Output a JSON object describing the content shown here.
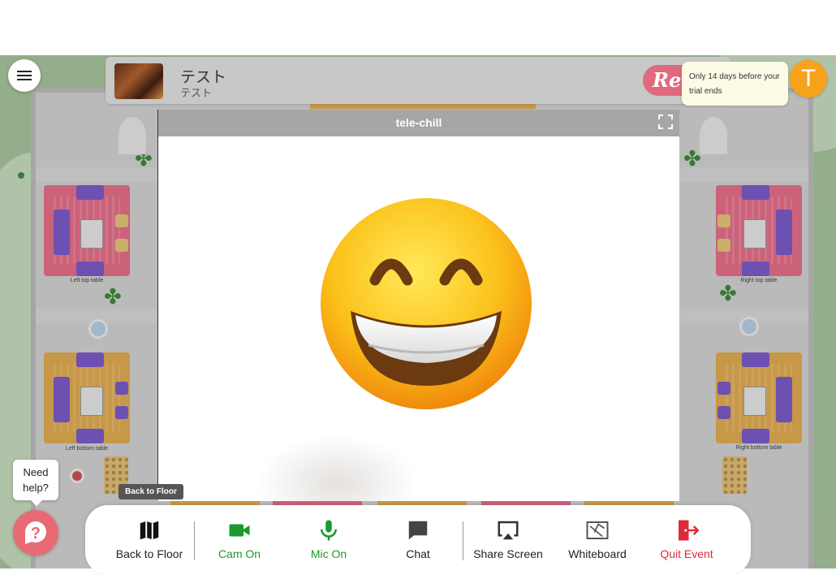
{
  "event": {
    "title": "テスト",
    "subtitle": "テスト",
    "brand_text": "Re"
  },
  "trial_notice": "Only 14 days before your trial ends",
  "avatar_initial": "T",
  "video": {
    "title": "tele-chill"
  },
  "tooltip": "Back to Floor",
  "help": {
    "text_line1": "Need",
    "text_line2": "help?"
  },
  "tables": {
    "left_top": "Left top table",
    "right_top": "Right top table",
    "left_bottom": "Left bottom table",
    "right_bottom": "Right bottom table"
  },
  "toolbar": {
    "back_to_floor": "Back to Floor",
    "cam_on": "Cam On",
    "mic_on": "Mic On",
    "chat": "Chat",
    "share_screen": "Share Screen",
    "whiteboard": "Whiteboard",
    "quit_event": "Quit Event"
  },
  "colors": {
    "on_green": "#1a9a2a",
    "quit_red": "#e02a3a",
    "avatar": "#f7a21b",
    "help": "#e86a75"
  }
}
